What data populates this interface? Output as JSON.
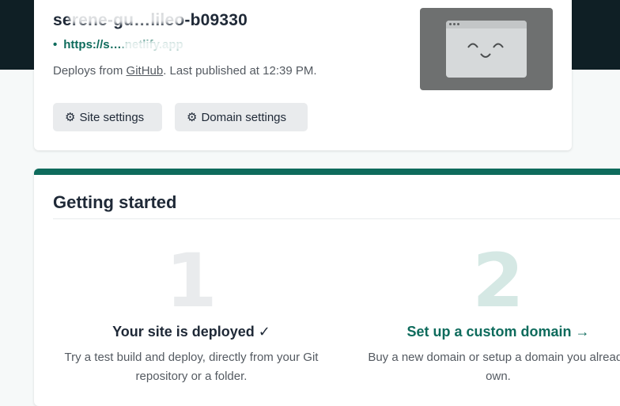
{
  "site": {
    "name": "serene-gu…lileo-b09330",
    "url": "https://s….netlify.app",
    "deploy_prefix": "Deploys from ",
    "deploy_source": "GitHub",
    "deploy_suffix": ". Last published at 12:39 PM.",
    "site_settings_label": "Site settings",
    "domain_settings_label": "Domain settings"
  },
  "getting_started": {
    "title": "Getting started",
    "steps": [
      {
        "number": "1",
        "title": "Your site is deployed ✓",
        "description": "Try a test build and deploy, directly from your Git repository or a folder."
      },
      {
        "number": "2",
        "title": "Set up a custom domain →",
        "description": "Buy a new domain or setup a domain you already own."
      }
    ]
  },
  "colors": {
    "accent": "#0e6b5c",
    "header_dark": "#0f1f25"
  },
  "icons": {
    "gear": "gear-icon",
    "bullet": "bullet-dot-icon",
    "preview": "site-preview-face-icon"
  }
}
